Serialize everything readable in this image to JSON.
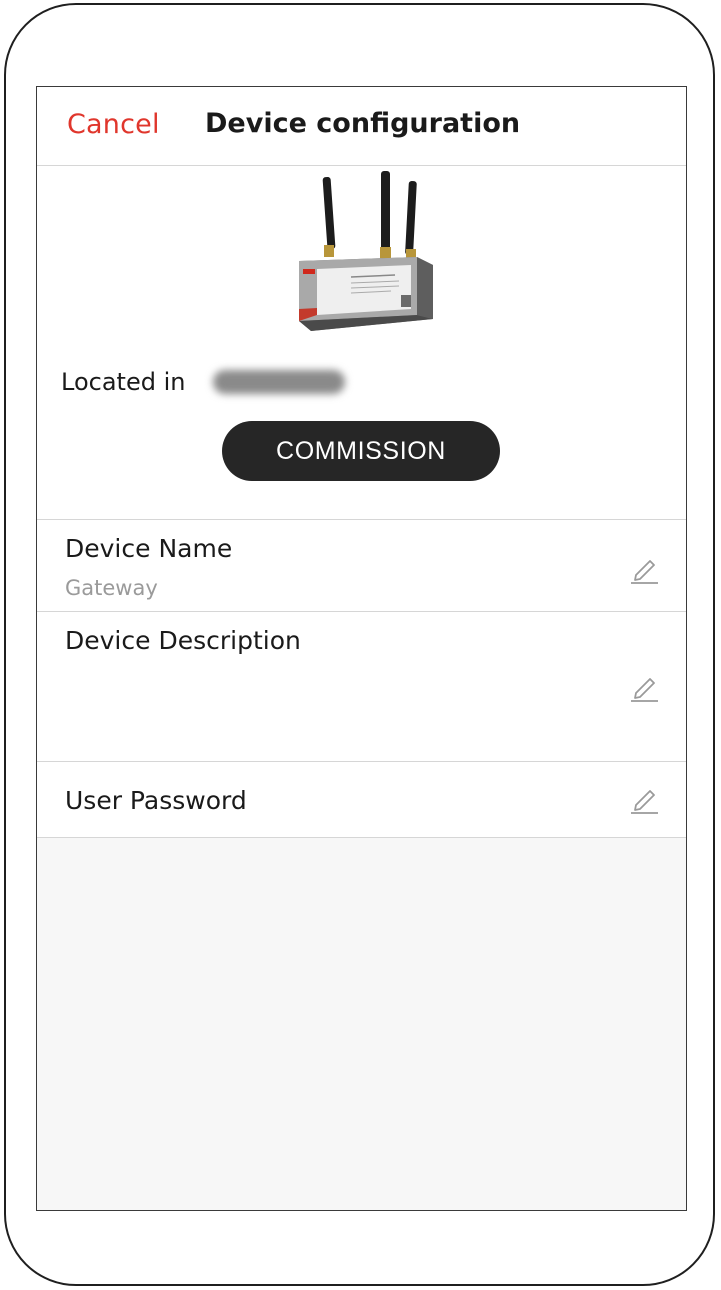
{
  "nav": {
    "cancel_label": "Cancel",
    "title": "Device configuration"
  },
  "device": {
    "image_icon": "gateway-device-image",
    "located_label": "Located in",
    "located_value_redacted": true
  },
  "commission_button": {
    "label": "COMMISSION"
  },
  "fields": {
    "name": {
      "label": "Device Name",
      "value": "Gateway",
      "icon": "pencil-edit-icon"
    },
    "description": {
      "label": "Device Description",
      "value": "",
      "icon": "pencil-edit-icon"
    },
    "password": {
      "label": "User Password",
      "icon": "pencil-edit-icon"
    }
  },
  "colors": {
    "accent_cancel": "#e0362c",
    "button_bg": "#262626",
    "secondary_text": "#9a9a9a"
  }
}
